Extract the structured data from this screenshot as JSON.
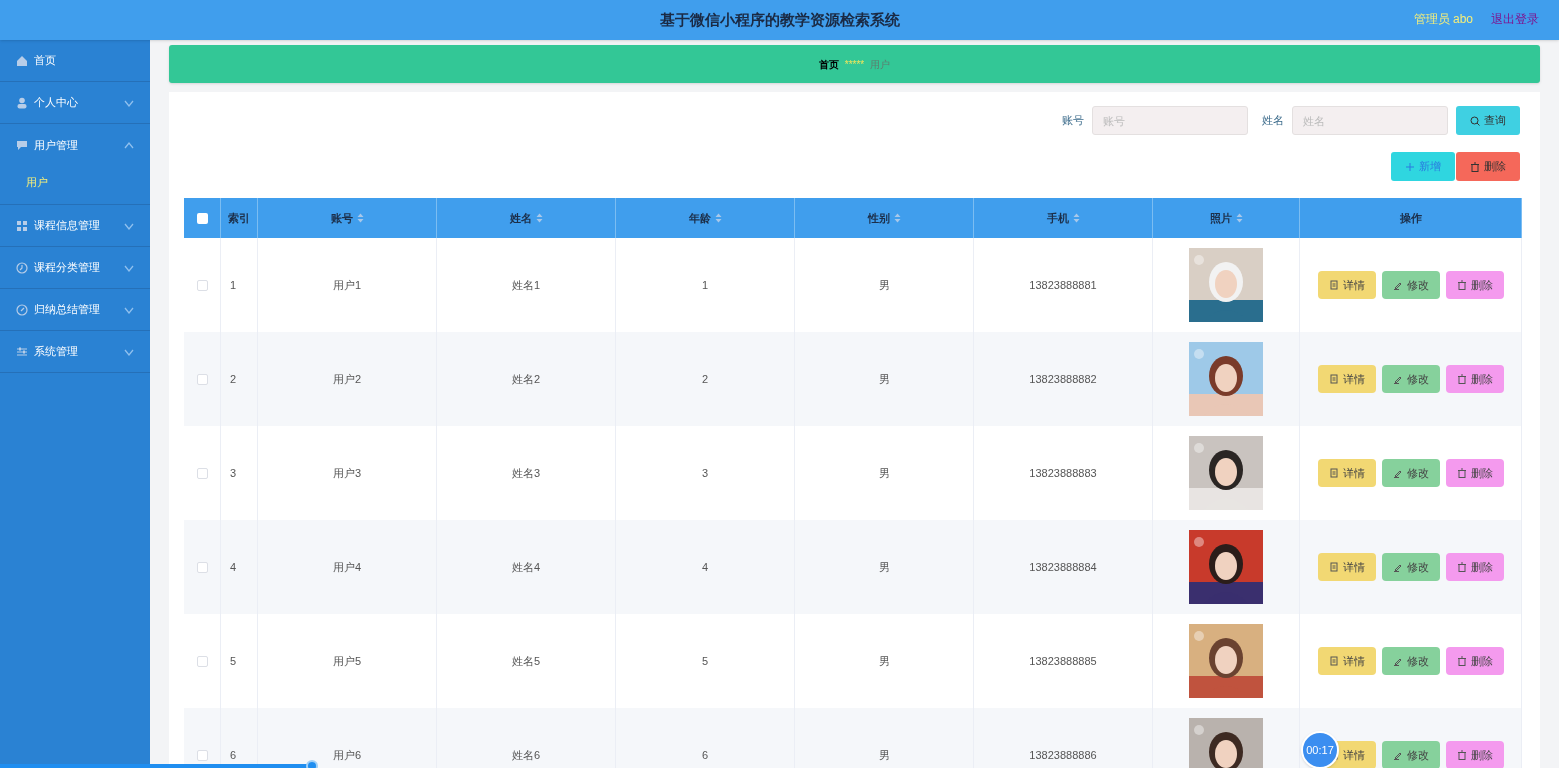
{
  "header": {
    "title": "基于微信小程序的教学资源检索系统",
    "user": "管理员 abo",
    "logout": "退出登录"
  },
  "sidebar": {
    "items": [
      {
        "label": "首页"
      },
      {
        "label": "个人中心",
        "expanded": false
      },
      {
        "label": "用户管理",
        "expanded": true,
        "children": [
          {
            "label": "用户",
            "selected": true
          }
        ]
      },
      {
        "label": "课程信息管理",
        "expanded": false
      },
      {
        "label": "课程分类管理",
        "expanded": false
      },
      {
        "label": "归纳总结管理",
        "expanded": false
      },
      {
        "label": "系统管理",
        "expanded": false
      }
    ]
  },
  "breadcrumb": {
    "home": "首页",
    "separator": "*****",
    "current": "用户"
  },
  "search": {
    "fields": [
      {
        "label": "账号",
        "placeholder": "账号"
      },
      {
        "label": "姓名",
        "placeholder": "姓名"
      }
    ],
    "button": "查询"
  },
  "actions": [
    {
      "kind": "add",
      "label": "新增"
    },
    {
      "kind": "delete",
      "label": "删除"
    }
  ],
  "table": {
    "select_all": {
      "checked": false
    },
    "columns": [
      {
        "label": "索引",
        "sortable": false
      },
      {
        "label": "账号",
        "sortable": true
      },
      {
        "label": "姓名",
        "sortable": true
      },
      {
        "label": "年龄",
        "sortable": true
      },
      {
        "label": "性别",
        "sortable": true
      },
      {
        "label": "手机",
        "sortable": true
      },
      {
        "label": "照片",
        "sortable": true
      },
      {
        "label": "操作",
        "sortable": false
      }
    ],
    "rows": [
      {
        "checked": false,
        "index": "1",
        "account": "用户1",
        "name": "姓名1",
        "age": "1",
        "gender": "男",
        "phone": "13823888881",
        "actions": [
          {
            "kind": "detail",
            "label": "详情"
          },
          {
            "kind": "edit",
            "label": "修改"
          },
          {
            "kind": "delete",
            "label": "删除"
          }
        ]
      },
      {
        "checked": false,
        "index": "2",
        "account": "用户2",
        "name": "姓名2",
        "age": "2",
        "gender": "男",
        "phone": "13823888882",
        "actions": [
          {
            "kind": "detail",
            "label": "详情"
          },
          {
            "kind": "edit",
            "label": "修改"
          },
          {
            "kind": "delete",
            "label": "删除"
          }
        ]
      },
      {
        "checked": false,
        "index": "3",
        "account": "用户3",
        "name": "姓名3",
        "age": "3",
        "gender": "男",
        "phone": "13823888883",
        "actions": [
          {
            "kind": "detail",
            "label": "详情"
          },
          {
            "kind": "edit",
            "label": "修改"
          },
          {
            "kind": "delete",
            "label": "删除"
          }
        ]
      },
      {
        "checked": false,
        "index": "4",
        "account": "用户4",
        "name": "姓名4",
        "age": "4",
        "gender": "男",
        "phone": "13823888884",
        "actions": [
          {
            "kind": "detail",
            "label": "详情"
          },
          {
            "kind": "edit",
            "label": "修改"
          },
          {
            "kind": "delete",
            "label": "删除"
          }
        ]
      },
      {
        "checked": false,
        "index": "5",
        "account": "用户5",
        "name": "姓名5",
        "age": "5",
        "gender": "男",
        "phone": "13823888885",
        "actions": [
          {
            "kind": "detail",
            "label": "详情"
          },
          {
            "kind": "edit",
            "label": "修改"
          },
          {
            "kind": "delete",
            "label": "删除"
          }
        ]
      },
      {
        "checked": false,
        "index": "6",
        "account": "用户6",
        "name": "姓名6",
        "age": "6",
        "gender": "男",
        "phone": "13823888886",
        "actions": [
          {
            "kind": "detail",
            "label": "详情"
          },
          {
            "kind": "edit",
            "label": "修改"
          },
          {
            "kind": "delete",
            "label": "删除"
          }
        ]
      }
    ]
  },
  "recording": {
    "timer": "00:17",
    "level": 0.2
  }
}
